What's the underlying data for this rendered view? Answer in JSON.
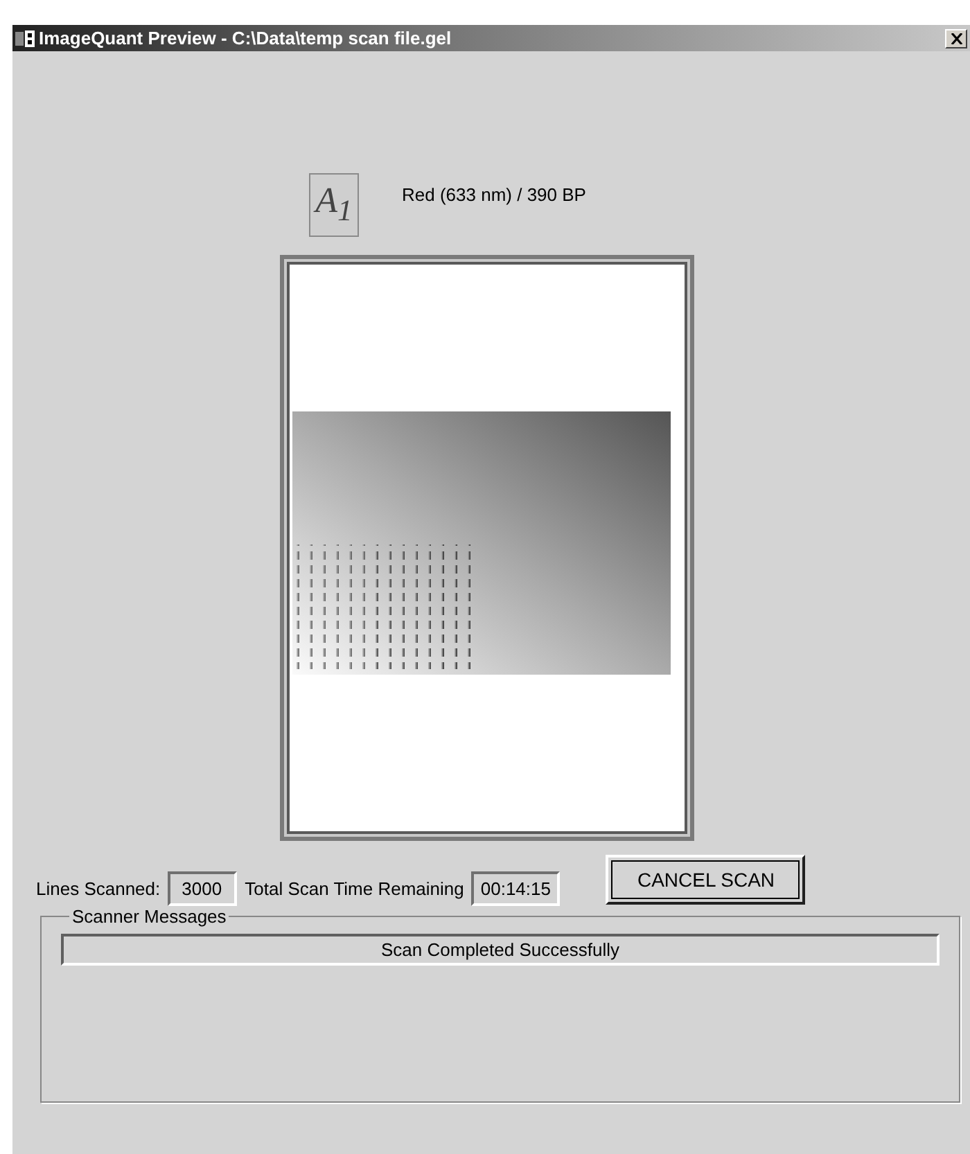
{
  "window": {
    "title": "ImageQuant Preview - C:\\Data\\temp scan file.gel"
  },
  "preview": {
    "channel_badge": "A$_{1}$",
    "channel_label": "Red (633 nm) / 390 BP"
  },
  "status": {
    "lines_label": "Lines Scanned:",
    "lines_value": "3000",
    "time_label": "Total Scan Time Remaining",
    "time_value": "00:14:15"
  },
  "cancel_button": "CANCEL SCAN",
  "messages": {
    "title": "Scanner Messages",
    "text": "Scan Completed Successfully"
  }
}
